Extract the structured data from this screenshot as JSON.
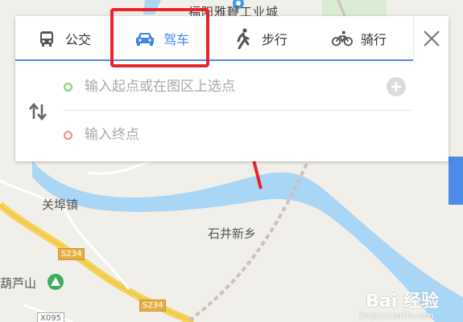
{
  "map": {
    "labels": {
      "top_partial": "福阳雅鞭工业城",
      "guanfu_town": "关埠镇",
      "shijing_xinxiang": "石井新乡",
      "hulushan": "葫芦山"
    },
    "road_badges": {
      "s234_upper": "S234",
      "s234_lower": "S234",
      "x095": "X095"
    },
    "watermark": "Bai 经验",
    "watermark_sub": "jingyan.baidu.com",
    "colors": {
      "water": "#a9d6f5",
      "road": "#f5d25a",
      "land": "#f1efe9"
    }
  },
  "tabs": [
    {
      "label": "公交",
      "icon": "bus-icon",
      "active": false
    },
    {
      "label": "驾车",
      "icon": "car-icon",
      "active": true
    },
    {
      "label": "步行",
      "icon": "walk-icon",
      "active": false
    },
    {
      "label": "骑行",
      "icon": "bike-icon",
      "active": false
    }
  ],
  "route": {
    "start_placeholder": "输入起点或在图区上选点",
    "end_placeholder": "输入终点"
  },
  "accent": "#3d86e6",
  "annotation_color": "#e8242a"
}
